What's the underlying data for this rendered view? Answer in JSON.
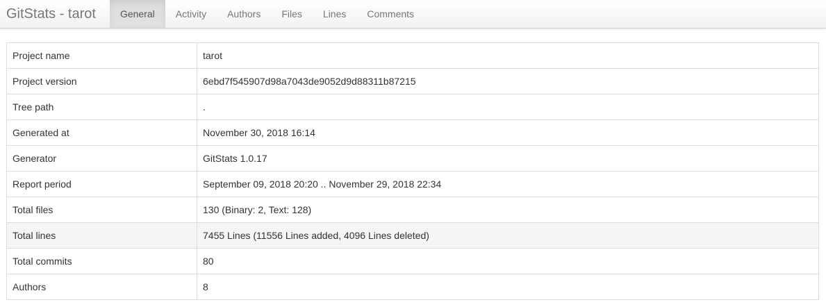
{
  "navbar": {
    "brand": "GitStats - tarot",
    "tabs": [
      {
        "label": "General",
        "active": true
      },
      {
        "label": "Activity",
        "active": false
      },
      {
        "label": "Authors",
        "active": false
      },
      {
        "label": "Files",
        "active": false
      },
      {
        "label": "Lines",
        "active": false
      },
      {
        "label": "Comments",
        "active": false
      }
    ]
  },
  "general": {
    "rows": [
      {
        "key": "Project name",
        "value": "tarot"
      },
      {
        "key": "Project version",
        "value": "6ebd7f545907d98a7043de9052d9d88311b87215"
      },
      {
        "key": "Tree path",
        "value": "."
      },
      {
        "key": "Generated at",
        "value": "November 30, 2018 16:14"
      },
      {
        "key": "Generator",
        "value": "GitStats 1.0.17"
      },
      {
        "key": "Report period",
        "value": "September 09, 2018 20:20 .. November 29, 2018 22:34"
      },
      {
        "key": "Total files",
        "value": "130 (Binary: 2, Text: 128)"
      },
      {
        "key": "Total lines",
        "value": "7455 Lines (11556 Lines added, 4096 Lines deleted)"
      },
      {
        "key": "Total commits",
        "value": "80"
      },
      {
        "key": "Authors",
        "value": "8"
      }
    ],
    "highlighted_row_index": 7
  },
  "colors": {
    "brand_text": "#777777",
    "active_tab_bg": "#e0e0e0",
    "row_highlight": "#f5f5f5",
    "border": "#dddddd"
  }
}
